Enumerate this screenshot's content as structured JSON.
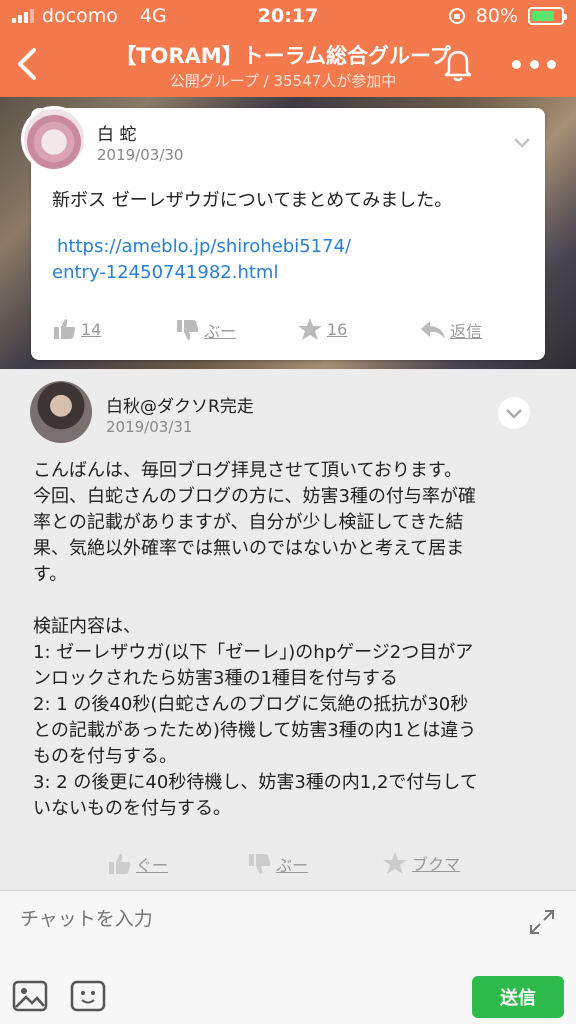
{
  "status_bar": {
    "carrier": "docomo",
    "network": "4G",
    "time": "20:17",
    "battery": "80%",
    "battery_level": 0.8
  },
  "header": {
    "title": "【TORAM】トーラム総合グループ",
    "subtitle": "公開グループ / 35547人が参加中",
    "icons": [
      "back-arrow-icon",
      "bell-icon",
      "more-dots-icon"
    ],
    "color": "#f47a4e"
  },
  "pinned_post": {
    "author": "白 蛇",
    "date": "2019/03/30",
    "text": "新ボス ゼーレザウガについてまとめてみました。",
    "link_line1": "https://ameblo.jp/shirohebi5174/",
    "link_line2": "entry-12450741982.html",
    "actions": {
      "like_count": "14",
      "dislike_label": "ぶー",
      "star_count": "16",
      "reply_label": "返信"
    }
  },
  "comment": {
    "author": "白秋@ダクソR完走",
    "date": "2019/03/31",
    "body": [
      "こんばんは、毎回ブログ拝見させて頂いております。",
      "今回、白蛇さんのブログの方に、妨害3種の付与率が確",
      "率との記載がありますが、自分が少し検証してきた結",
      "果、気絶以外確率では無いのではないかと考えて居ま",
      "す。",
      "",
      "検証内容は、",
      "1: ゼーレザウガ(以下「ゼーレ」)のhpゲージ2つ目がア",
      "ンロックされたら妨害3種の1種目を付与する",
      "2: 1 の後40秒(白蛇さんのブログに気絶の抵抗が30秒",
      "との記載があったため)待機して妨害3種の内1とは違う",
      "ものを付与する。",
      "3: 2 の後更に40秒待機し、妨害3種の内1,2で付与して",
      "いないものを付与する。"
    ],
    "actions": {
      "like_label": "ぐー",
      "dislike_label": "ぶー",
      "bookmark_label": "ブクマ"
    }
  },
  "composer": {
    "placeholder": "チャットを入力",
    "send_label": "送信",
    "send_color": "#2fba4c"
  },
  "link_color": "#2a7fd1"
}
